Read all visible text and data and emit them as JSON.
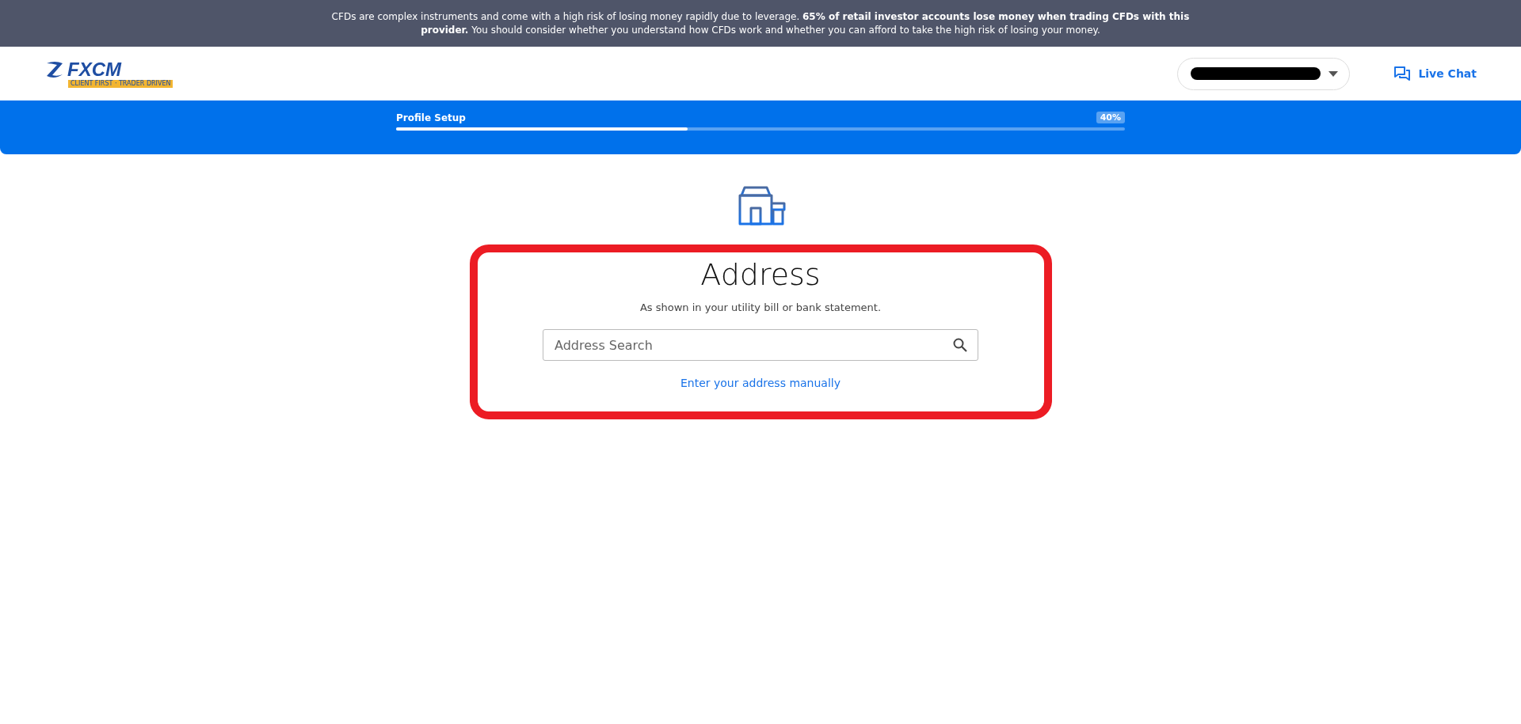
{
  "risk_banner": {
    "text": "CFDs are complex instruments and come with a high risk of losing money rapidly due to leverage. **65% of retail investor accounts lose money when trading CFDs with this provider.** You should consider whether you understand how CFDs work and whether you can afford to take the high risk of losing your money."
  },
  "header": {
    "logo": {
      "name": "FXCM",
      "tagline": "CLIENT FIRST · TRADER DRIVEN"
    },
    "account_dropdown": {
      "redacted": true
    },
    "live_chat": "Live Chat"
  },
  "progress": {
    "label": "Profile Setup",
    "percent": "40%",
    "level": 0.4
  },
  "card": {
    "title": "Address",
    "subtitle": "As shown in your utility bill or bank statement.",
    "search": {
      "placeholder": "Address Search"
    },
    "manual_link": "Enter your address manually"
  }
}
